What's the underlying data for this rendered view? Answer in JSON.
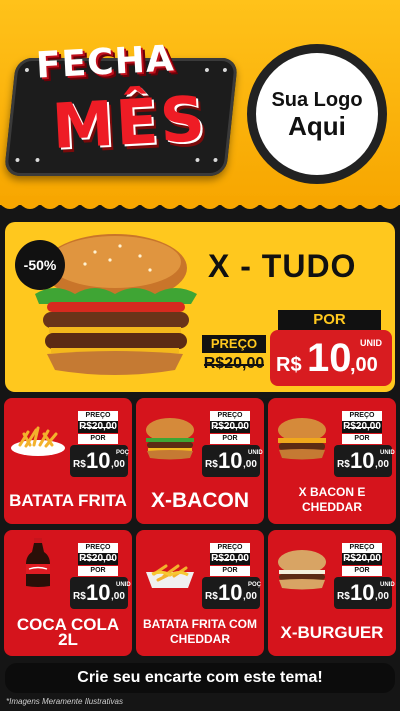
{
  "header": {
    "badge_top": "FECHA",
    "badge_main": "MÊS",
    "logo_line1": "Sua Logo",
    "logo_line2": "Aqui",
    "colors": {
      "yellow": "#ffc21a",
      "red": "#ee1c25",
      "dark": "#151515"
    }
  },
  "hero": {
    "discount": "-50%",
    "title": "X - TUDO",
    "por": "POR",
    "preco_label": "PREÇO",
    "old_price": "R$20,00",
    "currency": "R$",
    "price_int": "10",
    "price_dec": ",00",
    "unit": "UNID",
    "image": "burger-icon"
  },
  "products": [
    {
      "name": "BATATA FRITA",
      "preco": "PREÇO",
      "old": "R$20,00",
      "por": "POR",
      "currency": "R$",
      "price_int": "10",
      "price_dec": ",00",
      "unit": "POÇ",
      "image": "fries-icon"
    },
    {
      "name": "X-BACON",
      "preco": "PREÇO",
      "old": "R$20,00",
      "por": "POR",
      "currency": "R$",
      "price_int": "10",
      "price_dec": ",00",
      "unit": "UNID",
      "image": "burger-icon"
    },
    {
      "name": "X BACON E CHEDDAR",
      "preco": "PREÇO",
      "old": "R$20,00",
      "por": "POR",
      "currency": "R$",
      "price_int": "10",
      "price_dec": ",00",
      "unit": "UNID",
      "image": "burger-icon"
    },
    {
      "name": "COCA COLA 2L",
      "preco": "PREÇO",
      "old": "R$20,00",
      "por": "POR",
      "currency": "R$",
      "price_int": "10",
      "price_dec": ",00",
      "unit": "UNID",
      "image": "soda-bottle-icon"
    },
    {
      "name": "BATATA FRITA COM CHEDDAR",
      "preco": "PREÇO",
      "old": "R$20,00",
      "por": "POR",
      "currency": "R$",
      "price_int": "10",
      "price_dec": ",00",
      "unit": "POÇ",
      "image": "fries-icon"
    },
    {
      "name": "X-BURGUER",
      "preco": "PREÇO",
      "old": "R$20,00",
      "por": "POR",
      "currency": "R$",
      "price_int": "10",
      "price_dec": ",00",
      "unit": "UNID",
      "image": "burger-icon"
    }
  ],
  "cta": "Crie seu encarte com este tema!",
  "footnote": "*Imagens Meramente Ilustrativas"
}
